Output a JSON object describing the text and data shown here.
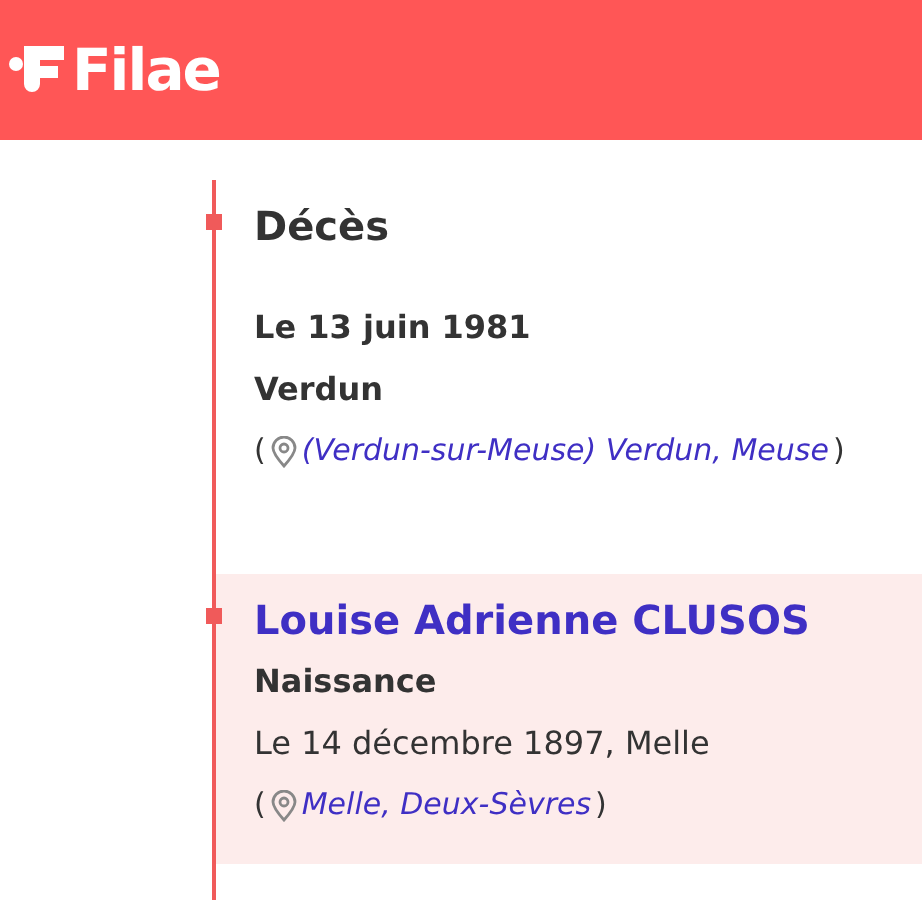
{
  "header": {
    "logo": "Filae"
  },
  "events": [
    {
      "highlighted": false,
      "type": "Décès",
      "lines": [
        {
          "text": "Le 13 juin 1981",
          "bold": true
        },
        {
          "text": "Verdun",
          "bold": true
        }
      ],
      "location": {
        "open": "(",
        "place": "(Verdun-sur-Meuse) Verdun, Meuse",
        "close": ")"
      }
    },
    {
      "highlighted": true,
      "person": "Louise Adrienne CLUSOS",
      "type": "Naissance",
      "lines": [
        {
          "text": "Le 14 décembre 1897, Melle",
          "bold": false
        }
      ],
      "location": {
        "open": "(",
        "place": "Melle, Deux-Sèvres",
        "close": ")"
      }
    }
  ]
}
